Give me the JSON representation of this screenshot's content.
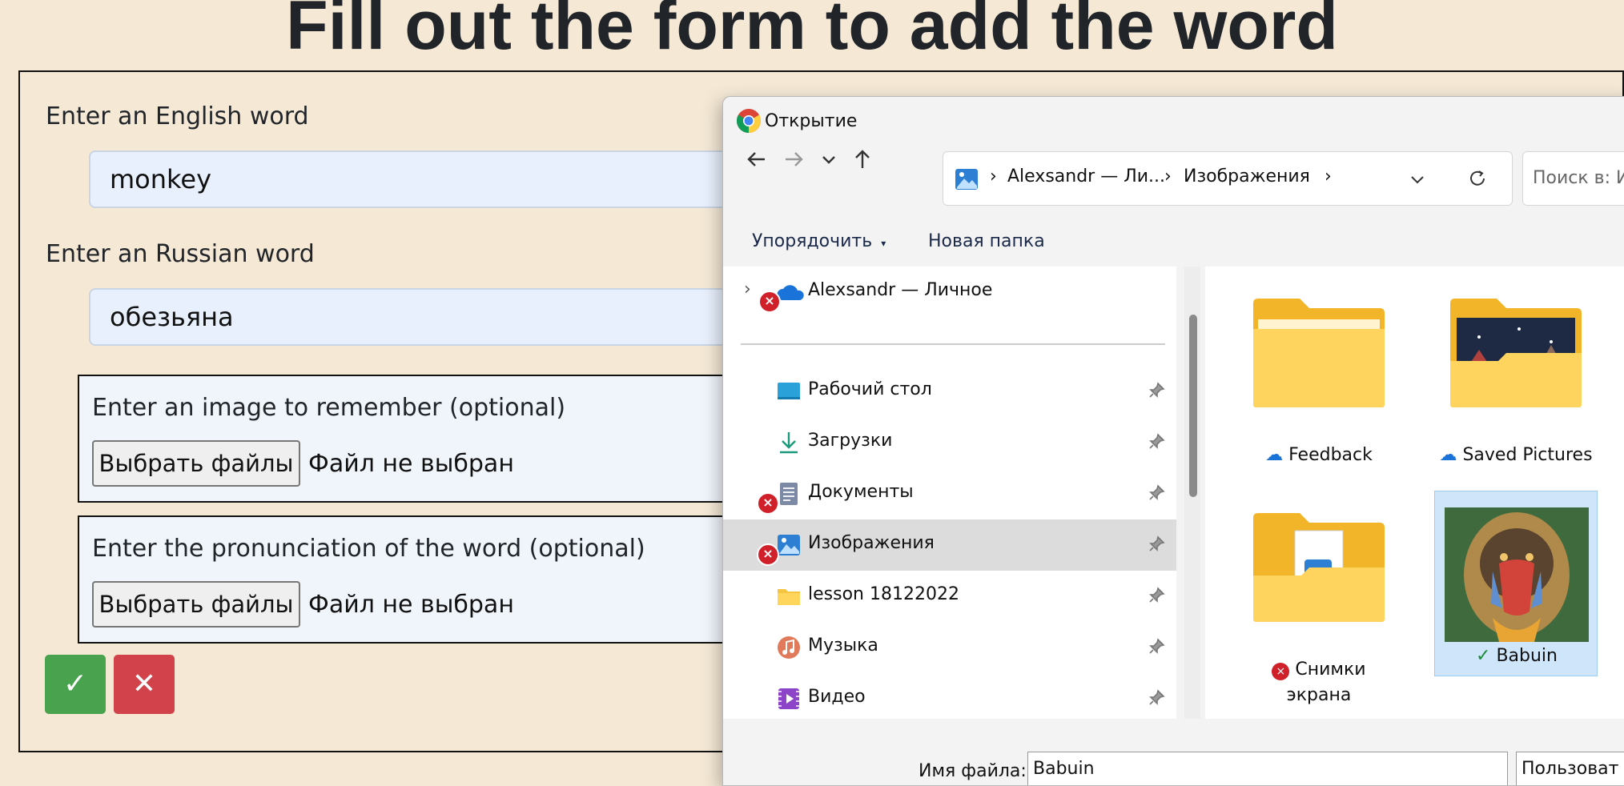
{
  "page": {
    "title": "Fill out the form to add the word"
  },
  "form": {
    "english_label": "Enter an English word",
    "english_value": "monkey",
    "russian_label": "Enter an Russian word",
    "russian_value": "обезьяна",
    "image_group": {
      "label": "Enter an image to remember (optional)",
      "button": "Выбрать файлы",
      "status": "Файл не выбран"
    },
    "audio_group": {
      "label": "Enter the pronunciation of the word (optional)",
      "button": "Выбрать файлы",
      "status": "Файл не выбран"
    },
    "submit_icon": "✓",
    "cancel_icon": "✕",
    "colors": {
      "submit": "#49a24d",
      "cancel": "#d2424b"
    }
  },
  "dialog": {
    "title": "Открытие",
    "breadcrumbs": [
      "Alexsandr — Ли...",
      "Изображения"
    ],
    "search_placeholder": "Поиск в: И",
    "commands": {
      "organize": "Упорядочить",
      "new_folder": "Новая папка"
    },
    "nav_root": "Alexsandr — Личное",
    "nav_items": [
      {
        "label": "Рабочий стол",
        "icon": "desktop-icon"
      },
      {
        "label": "Загрузки",
        "icon": "download-icon"
      },
      {
        "label": "Документы",
        "icon": "documents-icon"
      },
      {
        "label": "Изображения",
        "icon": "pictures-icon"
      },
      {
        "label": "lesson 18122022",
        "icon": "folder-icon"
      },
      {
        "label": "Музыка",
        "icon": "music-icon"
      },
      {
        "label": "Видео",
        "icon": "video-icon"
      }
    ],
    "files": [
      {
        "label": "Feedback",
        "status": "cloud"
      },
      {
        "label": "Saved Pictures",
        "status": "cloud"
      },
      {
        "label": "Снимки экрана",
        "status": "error"
      },
      {
        "label": "Babuin",
        "status": "synced"
      }
    ],
    "filename_label": "Имя файла:",
    "filename_value": "Babuin",
    "filetype_value": "Пользоват"
  }
}
